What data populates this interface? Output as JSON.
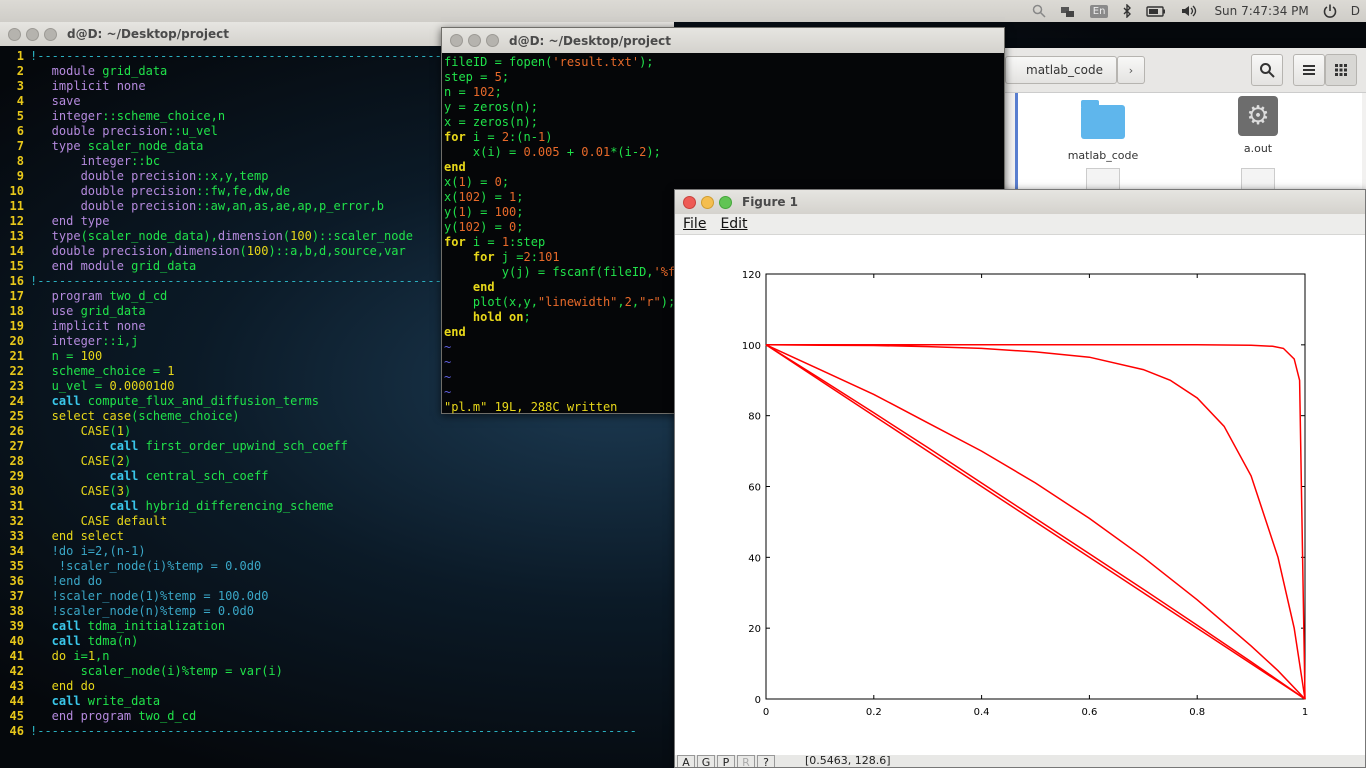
{
  "topbar": {
    "lang": "En",
    "clock": "Sun 7:47:34 PM",
    "user": "D"
  },
  "terminal_main": {
    "title": "d@D: ~/Desktop/project",
    "lines": [
      {
        "n": "1",
        "segs": [
          {
            "c": "sep",
            "t": "!-----------------------------------------------------------------------------------"
          }
        ]
      },
      {
        "n": "2",
        "segs": [
          {
            "c": "k-purple",
            "t": "   module "
          },
          {
            "c": "k-green",
            "t": "grid_data"
          }
        ]
      },
      {
        "n": "3",
        "segs": [
          {
            "c": "k-purple",
            "t": "   implicit none"
          }
        ]
      },
      {
        "n": "4",
        "segs": [
          {
            "c": "k-purple",
            "t": "   save"
          }
        ]
      },
      {
        "n": "5",
        "segs": [
          {
            "c": "k-purple",
            "t": "   integer"
          },
          {
            "c": "k-green",
            "t": "::scheme_choice,n"
          }
        ]
      },
      {
        "n": "6",
        "segs": [
          {
            "c": "k-purple",
            "t": "   double precision"
          },
          {
            "c": "k-green",
            "t": "::u_vel"
          }
        ]
      },
      {
        "n": "7",
        "segs": [
          {
            "c": "k-purple",
            "t": "   type "
          },
          {
            "c": "k-green",
            "t": "scaler_node_data"
          }
        ]
      },
      {
        "n": "8",
        "segs": [
          {
            "c": "k-purple",
            "t": "       integer"
          },
          {
            "c": "k-green",
            "t": "::bc"
          }
        ]
      },
      {
        "n": "9",
        "segs": [
          {
            "c": "k-purple",
            "t": "       double precision"
          },
          {
            "c": "k-green",
            "t": "::x,y,temp"
          }
        ]
      },
      {
        "n": "10",
        "segs": [
          {
            "c": "k-purple",
            "t": "       double precision"
          },
          {
            "c": "k-green",
            "t": "::fw,fe,dw,de"
          }
        ]
      },
      {
        "n": "11",
        "segs": [
          {
            "c": "k-purple",
            "t": "       double precision"
          },
          {
            "c": "k-green",
            "t": "::aw,an,as,ae,ap,p_error,b"
          }
        ]
      },
      {
        "n": "12",
        "segs": [
          {
            "c": "k-purple",
            "t": "   end type"
          }
        ]
      },
      {
        "n": "13",
        "segs": [
          {
            "c": "k-purple",
            "t": "   type"
          },
          {
            "c": "k-green",
            "t": "(scaler_node_data),"
          },
          {
            "c": "k-purple",
            "t": "dimension"
          },
          {
            "c": "k-green",
            "t": "("
          },
          {
            "c": "k-yellow",
            "t": "100"
          },
          {
            "c": "k-green",
            "t": ")::scaler_node"
          }
        ]
      },
      {
        "n": "14",
        "segs": [
          {
            "c": "k-purple",
            "t": "   double precision"
          },
          {
            "c": "k-green",
            "t": ","
          },
          {
            "c": "k-purple",
            "t": "dimension"
          },
          {
            "c": "k-green",
            "t": "("
          },
          {
            "c": "k-yellow",
            "t": "100"
          },
          {
            "c": "k-green",
            "t": ")::a,b,d,source,var"
          }
        ]
      },
      {
        "n": "15",
        "segs": [
          {
            "c": "k-purple",
            "t": "   end module "
          },
          {
            "c": "k-green",
            "t": "grid_data"
          }
        ]
      },
      {
        "n": "16",
        "segs": [
          {
            "c": "sep",
            "t": "!-----------------------------------------------------------------------------------"
          }
        ]
      },
      {
        "n": "17",
        "segs": [
          {
            "c": "k-purple",
            "t": "   program "
          },
          {
            "c": "k-green",
            "t": "two_d_cd"
          }
        ]
      },
      {
        "n": "18",
        "segs": [
          {
            "c": "k-purple",
            "t": "   use "
          },
          {
            "c": "k-green",
            "t": "grid_data"
          }
        ]
      },
      {
        "n": "19",
        "segs": [
          {
            "c": "k-purple",
            "t": "   implicit none"
          }
        ]
      },
      {
        "n": "20",
        "segs": [
          {
            "c": "k-purple",
            "t": "   integer"
          },
          {
            "c": "k-green",
            "t": "::i,j"
          }
        ]
      },
      {
        "n": "21",
        "segs": [
          {
            "c": "k-green",
            "t": "   n = "
          },
          {
            "c": "k-yellow",
            "t": "100"
          }
        ]
      },
      {
        "n": "22",
        "segs": [
          {
            "c": "k-green",
            "t": "   scheme_choice = "
          },
          {
            "c": "k-yellow",
            "t": "1"
          }
        ]
      },
      {
        "n": "23",
        "segs": [
          {
            "c": "k-green",
            "t": "   u_vel = "
          },
          {
            "c": "k-yellow",
            "t": "0.00001d0"
          }
        ]
      },
      {
        "n": "24",
        "segs": [
          {
            "c": "k-cyan",
            "t": "   call "
          },
          {
            "c": "k-green",
            "t": "compute_flux_and_diffusion_terms"
          }
        ]
      },
      {
        "n": "25",
        "segs": [
          {
            "c": "k-yellow",
            "t": "   select case"
          },
          {
            "c": "k-green",
            "t": "(scheme_choice)"
          }
        ]
      },
      {
        "n": "26",
        "segs": [
          {
            "c": "k-yellow",
            "t": "       CASE"
          },
          {
            "c": "k-green",
            "t": "("
          },
          {
            "c": "k-yellow",
            "t": "1"
          },
          {
            "c": "k-green",
            "t": ")"
          }
        ]
      },
      {
        "n": "27",
        "segs": [
          {
            "c": "k-cyan",
            "t": "           call "
          },
          {
            "c": "k-green",
            "t": "first_order_upwind_sch_coeff"
          }
        ]
      },
      {
        "n": "28",
        "segs": [
          {
            "c": "k-yellow",
            "t": "       CASE"
          },
          {
            "c": "k-green",
            "t": "("
          },
          {
            "c": "k-yellow",
            "t": "2"
          },
          {
            "c": "k-green",
            "t": ")"
          }
        ]
      },
      {
        "n": "29",
        "segs": [
          {
            "c": "k-cyan",
            "t": "           call "
          },
          {
            "c": "k-green",
            "t": "central_sch_coeff"
          }
        ]
      },
      {
        "n": "30",
        "segs": [
          {
            "c": "k-yellow",
            "t": "       CASE"
          },
          {
            "c": "k-green",
            "t": "("
          },
          {
            "c": "k-yellow",
            "t": "3"
          },
          {
            "c": "k-green",
            "t": ")"
          }
        ]
      },
      {
        "n": "31",
        "segs": [
          {
            "c": "k-cyan",
            "t": "           call "
          },
          {
            "c": "k-green",
            "t": "hybrid_differencing_scheme"
          }
        ]
      },
      {
        "n": "32",
        "segs": [
          {
            "c": "k-yellow",
            "t": "       CASE default"
          }
        ]
      },
      {
        "n": "33",
        "segs": [
          {
            "c": "k-yellow",
            "t": "   end select"
          }
        ]
      },
      {
        "n": "34",
        "segs": [
          {
            "c": "k-teal",
            "t": "   !do i=2,(n-1)"
          }
        ]
      },
      {
        "n": "35",
        "segs": [
          {
            "c": "k-teal",
            "t": "    !scaler_node(i)%temp = 0.0d0"
          }
        ]
      },
      {
        "n": "36",
        "segs": [
          {
            "c": "k-teal",
            "t": "   !end do"
          }
        ]
      },
      {
        "n": "37",
        "segs": [
          {
            "c": "k-teal",
            "t": "   !scaler_node(1)%temp = 100.0d0"
          }
        ]
      },
      {
        "n": "38",
        "segs": [
          {
            "c": "k-teal",
            "t": "   !scaler_node(n)%temp = 0.0d0"
          }
        ]
      },
      {
        "n": "39",
        "segs": [
          {
            "c": "k-cyan",
            "t": "   call "
          },
          {
            "c": "k-green",
            "t": "tdma_initialization"
          }
        ]
      },
      {
        "n": "40",
        "segs": [
          {
            "c": "k-cyan",
            "t": "   call "
          },
          {
            "c": "k-green",
            "t": "tdma(n)"
          }
        ]
      },
      {
        "n": "41",
        "segs": [
          {
            "c": "k-yellow",
            "t": "   do "
          },
          {
            "c": "k-green",
            "t": "i="
          },
          {
            "c": "k-yellow",
            "t": "1"
          },
          {
            "c": "k-green",
            "t": ",n"
          }
        ]
      },
      {
        "n": "42",
        "segs": [
          {
            "c": "k-green",
            "t": "       scaler_node(i)%temp = var(i)"
          }
        ]
      },
      {
        "n": "43",
        "segs": [
          {
            "c": "k-yellow",
            "t": "   end do"
          }
        ]
      },
      {
        "n": "44",
        "segs": [
          {
            "c": "k-cyan",
            "t": "   call "
          },
          {
            "c": "k-green",
            "t": "write_data"
          }
        ]
      },
      {
        "n": "45",
        "segs": [
          {
            "c": "k-purple",
            "t": "   end program "
          },
          {
            "c": "k-green",
            "t": "two_d_cd"
          }
        ]
      },
      {
        "n": "46",
        "segs": [
          {
            "c": "sep",
            "t": "!-----------------------------------------------------------------------------------"
          }
        ]
      }
    ]
  },
  "terminal_matlab": {
    "title": "d@D: ~/Desktop/project",
    "lines": [
      [
        {
          "c": "",
          "t": "fileID = fopen("
        },
        {
          "c": "m-str",
          "t": "'result.txt'"
        },
        {
          "c": "",
          "t": ");"
        }
      ],
      [
        {
          "c": "",
          "t": "step = "
        },
        {
          "c": "m-num",
          "t": "5"
        },
        {
          "c": "",
          "t": ";"
        }
      ],
      [
        {
          "c": "",
          "t": "n = "
        },
        {
          "c": "m-num",
          "t": "102"
        },
        {
          "c": "",
          "t": ";"
        }
      ],
      [
        {
          "c": "",
          "t": "y = zeros(n);"
        }
      ],
      [
        {
          "c": "",
          "t": "x = zeros(n);"
        }
      ],
      [
        {
          "c": "m-kw",
          "t": "for"
        },
        {
          "c": "",
          "t": " i = "
        },
        {
          "c": "m-num",
          "t": "2"
        },
        {
          "c": "",
          "t": ":(n-"
        },
        {
          "c": "m-num",
          "t": "1"
        },
        {
          "c": "",
          "t": ")"
        }
      ],
      [
        {
          "c": "",
          "t": "    x(i) = "
        },
        {
          "c": "m-num",
          "t": "0.005"
        },
        {
          "c": "",
          "t": " + "
        },
        {
          "c": "m-num",
          "t": "0.01"
        },
        {
          "c": "",
          "t": "*(i-"
        },
        {
          "c": "m-num",
          "t": "2"
        },
        {
          "c": "",
          "t": ");"
        }
      ],
      [
        {
          "c": "m-kw",
          "t": "end"
        }
      ],
      [
        {
          "c": "",
          "t": "x("
        },
        {
          "c": "m-num",
          "t": "1"
        },
        {
          "c": "",
          "t": ") = "
        },
        {
          "c": "m-num",
          "t": "0"
        },
        {
          "c": "",
          "t": ";"
        }
      ],
      [
        {
          "c": "",
          "t": "x("
        },
        {
          "c": "m-num",
          "t": "102"
        },
        {
          "c": "",
          "t": ") = "
        },
        {
          "c": "m-num",
          "t": "1"
        },
        {
          "c": "",
          "t": ";"
        }
      ],
      [
        {
          "c": "",
          "t": "y("
        },
        {
          "c": "m-num",
          "t": "1"
        },
        {
          "c": "",
          "t": ") = "
        },
        {
          "c": "m-num",
          "t": "100"
        },
        {
          "c": "",
          "t": ";"
        }
      ],
      [
        {
          "c": "",
          "t": "y("
        },
        {
          "c": "m-num",
          "t": "102"
        },
        {
          "c": "",
          "t": ") = "
        },
        {
          "c": "m-num",
          "t": "0"
        },
        {
          "c": "",
          "t": ";"
        }
      ],
      [
        {
          "c": "m-kw",
          "t": "for"
        },
        {
          "c": "",
          "t": " i = "
        },
        {
          "c": "m-num",
          "t": "1"
        },
        {
          "c": "",
          "t": ":step"
        }
      ],
      [
        {
          "c": "m-kw",
          "t": "    for"
        },
        {
          "c": "",
          "t": " j ="
        },
        {
          "c": "m-num",
          "t": "2"
        },
        {
          "c": "",
          "t": ":"
        },
        {
          "c": "m-num",
          "t": "101"
        }
      ],
      [
        {
          "c": "",
          "t": "        y(j) = fscanf(fileID,"
        },
        {
          "c": "m-str",
          "t": "'%f'"
        }
      ],
      [
        {
          "c": "m-kw",
          "t": "    end"
        }
      ],
      [
        {
          "c": "",
          "t": "    plot(x,y,"
        },
        {
          "c": "m-str",
          "t": "\"linewidth\""
        },
        {
          "c": "",
          "t": ","
        },
        {
          "c": "m-num",
          "t": "2"
        },
        {
          "c": "",
          "t": ","
        },
        {
          "c": "m-str",
          "t": "\"r\""
        },
        {
          "c": "",
          "t": ");"
        }
      ],
      [
        {
          "c": "m-kw",
          "t": "    hold on"
        },
        {
          "c": "",
          "t": ";"
        }
      ],
      [
        {
          "c": "m-kw",
          "t": "end"
        }
      ],
      [
        {
          "c": "m-tilde",
          "t": "~"
        }
      ],
      [
        {
          "c": "m-tilde",
          "t": "~"
        }
      ],
      [
        {
          "c": "m-tilde",
          "t": "~"
        }
      ],
      [
        {
          "c": "m-tilde",
          "t": "~"
        }
      ],
      [
        {
          "c": "m-status",
          "t": "\"pl.m\" 19L, 288C written"
        }
      ]
    ]
  },
  "file_manager": {
    "path_button": "matlab_code",
    "items": [
      {
        "name": "matlab_code",
        "icon": "folder-icon"
      },
      {
        "name": "a.out",
        "icon": "executable-icon"
      }
    ]
  },
  "figure": {
    "title": "Figure 1",
    "menu": [
      "File",
      "Edit"
    ],
    "status_buttons": [
      "A",
      "G",
      "P",
      "R",
      "?"
    ],
    "coords": "[0.5463, 128.6]"
  },
  "chart_data": {
    "type": "line",
    "title": "",
    "xlabel": "",
    "ylabel": "",
    "xlim": [
      0,
      1
    ],
    "ylim": [
      0,
      120
    ],
    "xticks": [
      "0",
      "0.2",
      "0.4",
      "0.6",
      "0.8",
      "1"
    ],
    "yticks": [
      "0",
      "20",
      "40",
      "60",
      "80",
      "100",
      "120"
    ],
    "color": "#ff0000",
    "grid": false,
    "series": [
      {
        "x": [
          0,
          0.1,
          0.2,
          0.3,
          0.4,
          0.5,
          0.6,
          0.7,
          0.8,
          0.9,
          1
        ],
        "y": [
          100,
          90,
          80,
          70,
          60,
          50,
          40,
          30,
          20,
          10,
          0
        ]
      },
      {
        "x": [
          0,
          0.1,
          0.2,
          0.3,
          0.4,
          0.5,
          0.6,
          0.7,
          0.8,
          0.9,
          1
        ],
        "y": [
          100,
          90.5,
          80.8,
          71,
          61,
          51,
          41,
          31,
          20.8,
          10.5,
          0
        ]
      },
      {
        "x": [
          0,
          0.1,
          0.2,
          0.3,
          0.4,
          0.5,
          0.6,
          0.7,
          0.8,
          0.9,
          0.95,
          1
        ],
        "y": [
          100,
          93,
          86,
          78,
          70,
          61,
          51,
          40,
          28,
          15,
          8,
          0
        ]
      },
      {
        "x": [
          0,
          0.1,
          0.2,
          0.3,
          0.4,
          0.5,
          0.6,
          0.7,
          0.75,
          0.8,
          0.85,
          0.9,
          0.95,
          0.98,
          1
        ],
        "y": [
          100,
          99.9,
          99.8,
          99.5,
          99,
          98,
          96.5,
          93,
          90,
          85,
          77,
          63,
          40,
          20,
          0
        ]
      },
      {
        "x": [
          0,
          0.2,
          0.4,
          0.6,
          0.8,
          0.9,
          0.94,
          0.96,
          0.98,
          0.99,
          1
        ],
        "y": [
          100,
          100,
          100,
          100,
          100,
          99.9,
          99.6,
          99,
          96,
          90,
          0
        ]
      }
    ]
  }
}
